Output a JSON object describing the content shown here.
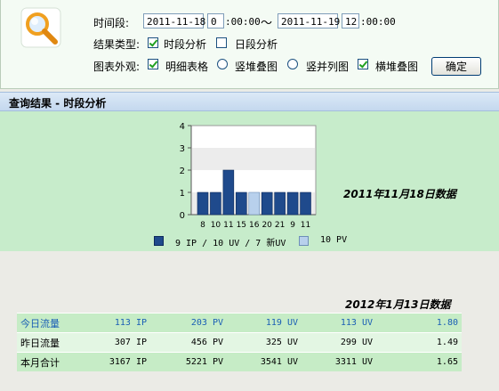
{
  "query": {
    "time_label": "时间段:",
    "start_date": "2011-11-18",
    "start_hour": "0",
    "start_rest": ":00:00",
    "separator": "～",
    "end_date": "2011-11-19",
    "end_hour": "12",
    "end_rest": ":00:00",
    "result_type_label": "结果类型:",
    "result_types": [
      {
        "label": "时段分析",
        "checked": true
      },
      {
        "label": "日段分析",
        "checked": false
      }
    ],
    "appearance_label": "图表外观:",
    "appearance_options": [
      {
        "label": "明细表格",
        "type": "checkbox",
        "checked": true
      },
      {
        "label": "竖堆叠图",
        "type": "radio",
        "checked": false
      },
      {
        "label": "竖并列图",
        "type": "radio",
        "checked": false
      },
      {
        "label": "横堆叠图",
        "type": "checkbox",
        "checked": true
      }
    ],
    "confirm_label": "确定"
  },
  "result_bar": {
    "title": "查询结果 - 时段分析"
  },
  "chart_data": {
    "type": "bar",
    "title": "2011年11月18日数据",
    "categories": [
      "8",
      "10",
      "11",
      "15",
      "16",
      "20",
      "21",
      "9",
      "11"
    ],
    "series": [
      {
        "name": "9 IP / 10 UV / 7 新UV",
        "color": "#1f4a8c",
        "values": [
          1,
          1,
          2,
          1,
          0,
          1,
          1,
          1,
          1
        ]
      },
      {
        "name": "10 PV",
        "color": "#b8d0ec",
        "values": [
          0,
          0,
          0,
          0,
          1,
          0,
          0,
          0,
          0
        ]
      }
    ],
    "ylim": [
      0,
      4
    ],
    "yticks": [
      "0",
      "1",
      "2",
      "3",
      "4"
    ],
    "legend_position": "bottom"
  },
  "stats": {
    "title": "2012年1月13日数据",
    "rows": [
      {
        "label": "今日流量",
        "ip": "113 IP",
        "pv": "203 PV",
        "uv": "119 UV",
        "uv2": "113 UV",
        "ratio": "1.80"
      },
      {
        "label": "昨日流量",
        "ip": "307 IP",
        "pv": "456 PV",
        "uv": "325 UV",
        "uv2": "299 UV",
        "ratio": "1.49"
      },
      {
        "label": "本月合计",
        "ip": "3167 IP",
        "pv": "5221 PV",
        "uv": "3541 UV",
        "uv2": "3311 UV",
        "ratio": "1.65"
      }
    ]
  }
}
